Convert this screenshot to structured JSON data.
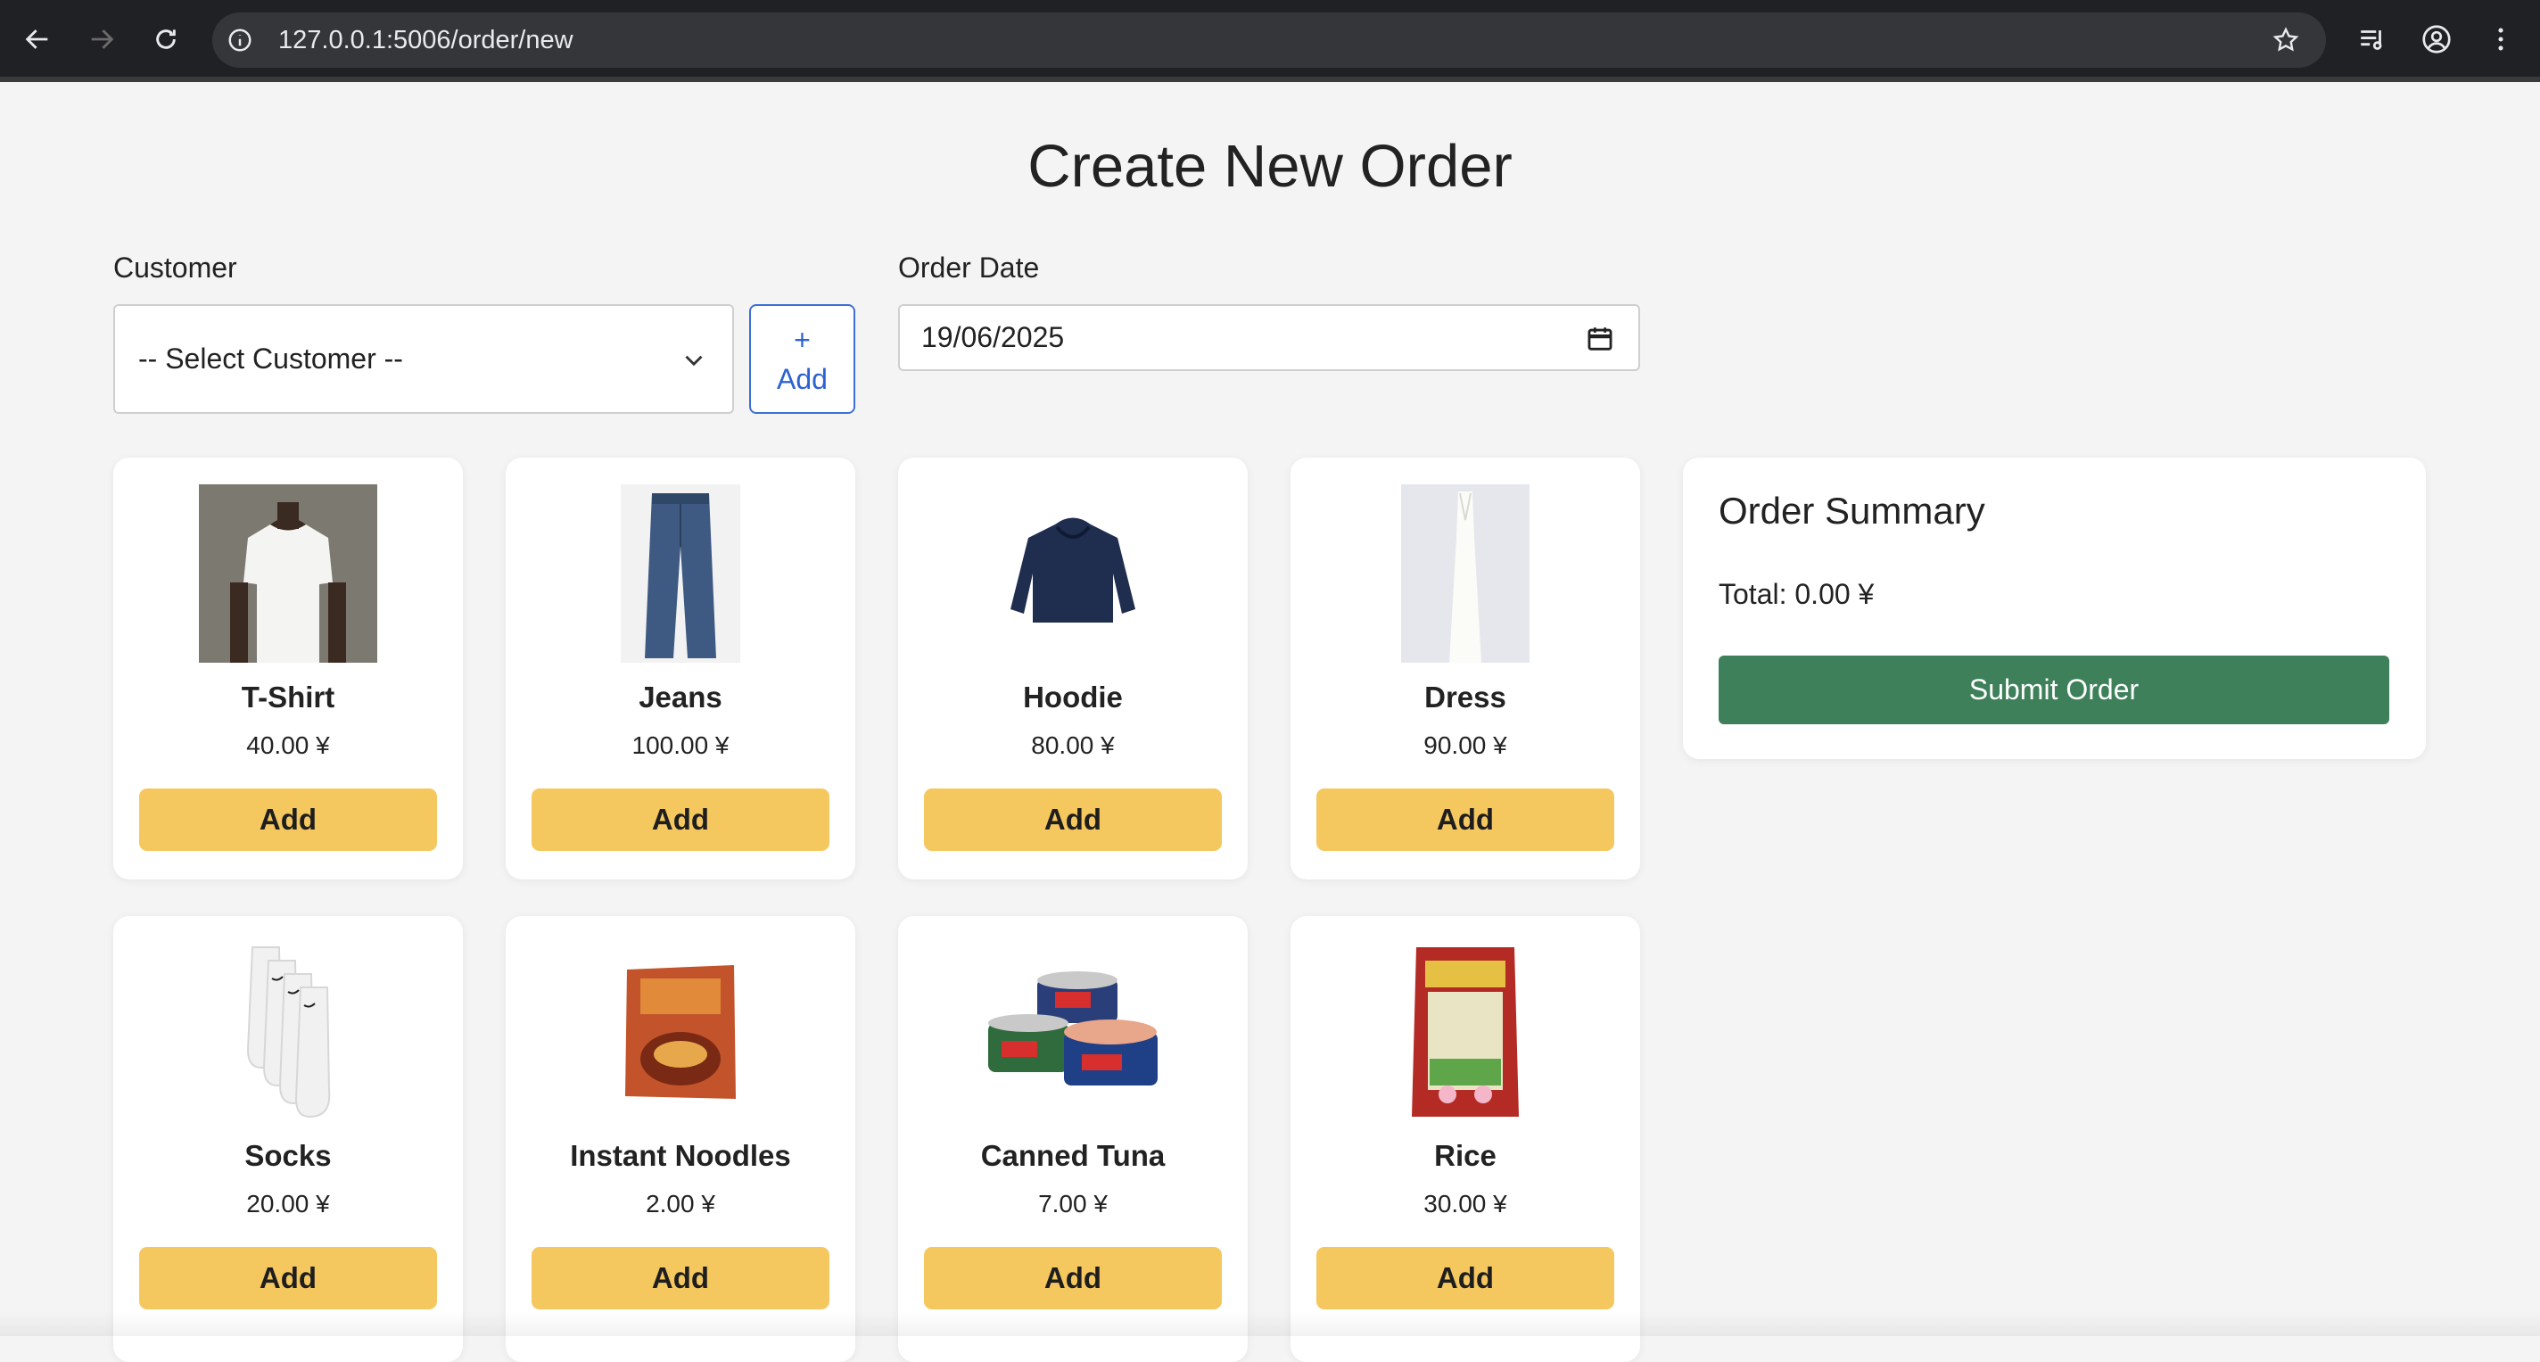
{
  "browser": {
    "url": "127.0.0.1:5006/order/new"
  },
  "page": {
    "title": "Create New Order"
  },
  "form": {
    "customer_label": "Customer",
    "customer_value": "-- Select Customer --",
    "add_customer_plus": "+",
    "add_customer_label": "Add",
    "order_date_label": "Order Date",
    "order_date_value": "19/06/2025"
  },
  "products": [
    {
      "name": "T-Shirt",
      "price": "40.00 ¥",
      "button": "Add",
      "icon": "tshirt-image"
    },
    {
      "name": "Jeans",
      "price": "100.00 ¥",
      "button": "Add",
      "icon": "jeans-image"
    },
    {
      "name": "Hoodie",
      "price": "80.00 ¥",
      "button": "Add",
      "icon": "hoodie-image"
    },
    {
      "name": "Dress",
      "price": "90.00 ¥",
      "button": "Add",
      "icon": "dress-image"
    },
    {
      "name": "Socks",
      "price": "20.00 ¥",
      "button": "Add",
      "icon": "socks-image"
    },
    {
      "name": "Instant Noodles",
      "price": "2.00 ¥",
      "button": "Add",
      "icon": "noodles-image"
    },
    {
      "name": "Canned Tuna",
      "price": "7.00 ¥",
      "button": "Add",
      "icon": "tuna-image"
    },
    {
      "name": "Rice",
      "price": "30.00 ¥",
      "button": "Add",
      "icon": "rice-image"
    }
  ],
  "summary": {
    "heading": "Order Summary",
    "total": "Total: 0.00 ¥",
    "submit": "Submit Order"
  },
  "colors": {
    "add_button": "#f5c75f",
    "submit_button": "#3d8059",
    "link_blue": "#2d63d0"
  }
}
